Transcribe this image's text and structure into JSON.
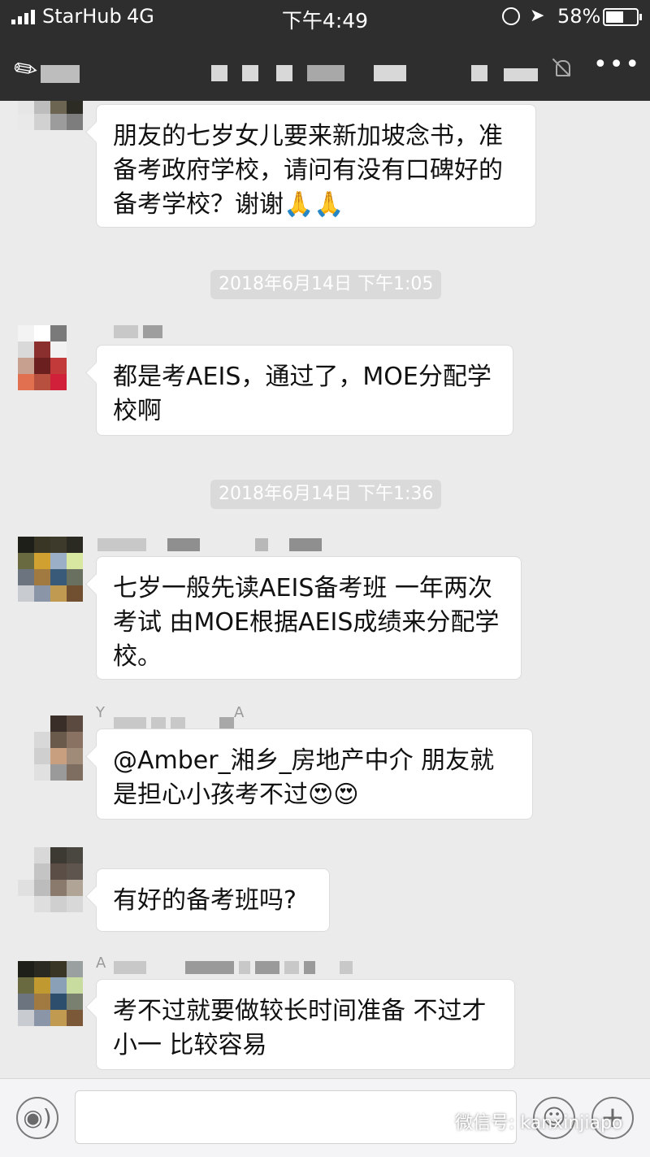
{
  "status_bar": {
    "carrier": "StarHub",
    "network": "4G",
    "time": "下午4:49",
    "battery": "58%",
    "battery_fraction": 0.58,
    "icons": [
      "signal-icon",
      "orientation-lock-icon",
      "location-icon",
      "battery-icon"
    ]
  },
  "nav_bar": {
    "icons": [
      "back-icon",
      "mute-icon",
      "more-icon"
    ],
    "more_glyph": "•••"
  },
  "timestamps": [
    "2018年6月14日 下午1:05",
    "2018年6月14日 下午1:36"
  ],
  "messages": [
    {
      "text": "朋友的七岁女儿要来新加坡念书，准备考政府学校，请问有没有口碑好的备考学校？谢谢",
      "emoji": "🙏🙏"
    },
    {
      "text": "都是考AEIS，通过了，MOE分配学校啊",
      "emoji": ""
    },
    {
      "text": "七岁一般先读AEIS备考班 一年两次考试 由MOE根据AEIS成绩来分配学校。",
      "emoji": ""
    },
    {
      "text": "@Amber_湘乡_房地产中介 朋友就是担心小孩考不过",
      "emoji": "😍😍"
    },
    {
      "text": "有好的备考班吗?",
      "emoji": ""
    },
    {
      "text": "考不过就要做较长时间准备 不过才小一 比较容易",
      "emoji": ""
    }
  ],
  "sender_initials": [
    "Y",
    "A",
    "A"
  ],
  "input_bar": {
    "voice_icon": "voice-icon",
    "emoji_icon": "emoji-icon",
    "plus_icon": "plus-icon",
    "watermark": "微信号: kanxinjiapo"
  }
}
